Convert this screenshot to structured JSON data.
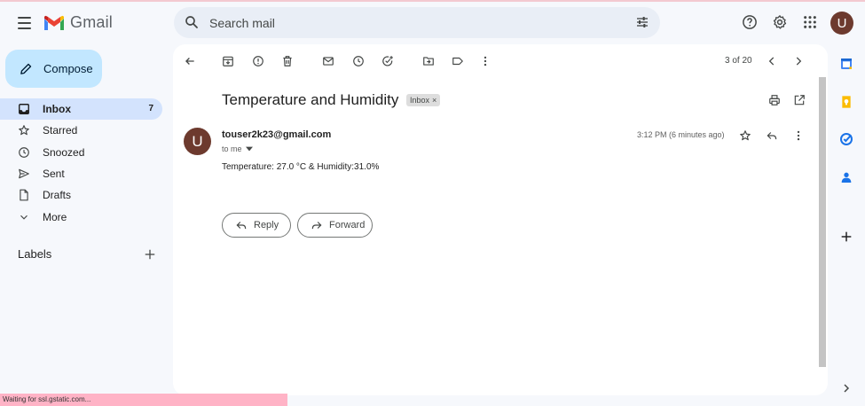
{
  "header": {
    "app_name": "Gmail",
    "search": {
      "placeholder": "Search mail"
    },
    "avatar_initial": "U"
  },
  "sidebar": {
    "compose_label": "Compose",
    "items": [
      {
        "label": "Inbox",
        "count": "7",
        "icon": "inbox-icon",
        "active": true
      },
      {
        "label": "Starred",
        "count": "",
        "icon": "star-icon"
      },
      {
        "label": "Snoozed",
        "count": "",
        "icon": "clock-icon"
      },
      {
        "label": "Sent",
        "count": "",
        "icon": "send-icon"
      },
      {
        "label": "Drafts",
        "count": "",
        "icon": "draft-icon"
      },
      {
        "label": "More",
        "count": "",
        "icon": "chevron-down-icon"
      }
    ],
    "labels_title": "Labels"
  },
  "toolbar": {
    "pager": "3 of 20"
  },
  "message": {
    "subject": "Temperature and Humidity",
    "label_chip": "Inbox",
    "chip_close": "×",
    "sender_initial": "U",
    "sender": "touser2k23@gmail.com",
    "to": "to me",
    "time": "3:12 PM (6 minutes ago)",
    "body": "Temperature: 27.0 °C  & Humidity:31.0%"
  },
  "actions": {
    "reply_label": "Reply",
    "forward_label": "Forward"
  },
  "status_bar": "Waiting for ssl.gstatic.com...",
  "colors": {
    "accent": "#d3e3fd",
    "compose": "#c2e7ff",
    "avatar": "#6d3a2e",
    "background": "#f6f8fc"
  }
}
